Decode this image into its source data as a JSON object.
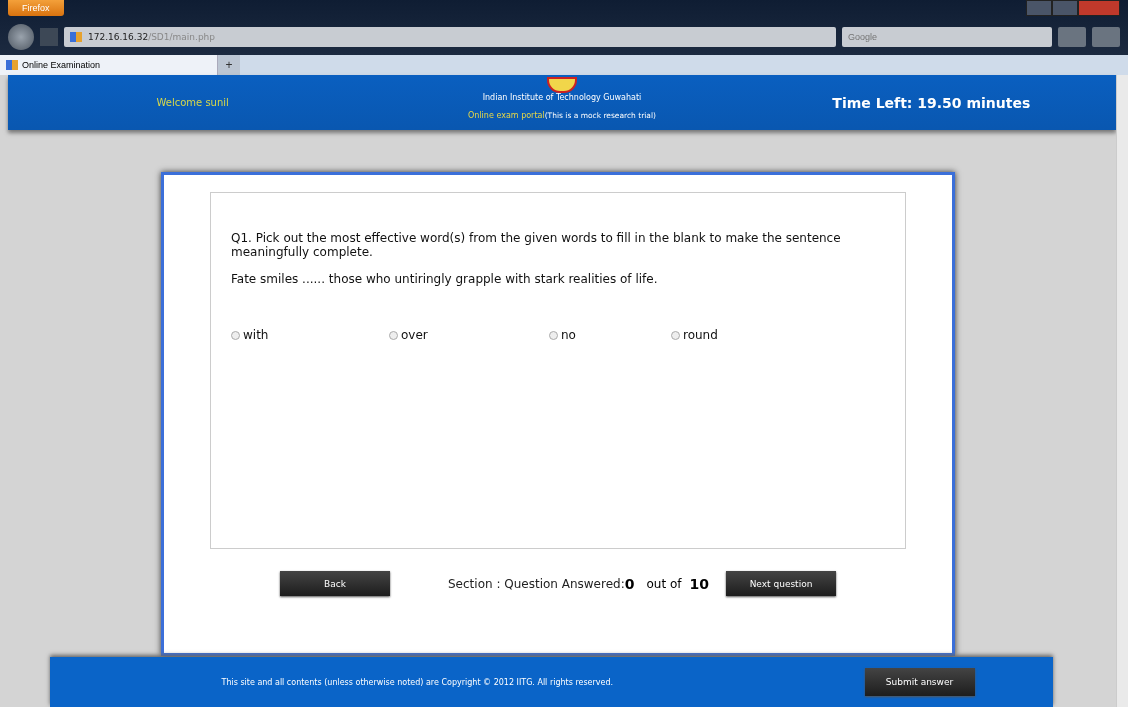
{
  "browser": {
    "menu_button": "Firefox",
    "url_host": "172.16.16.32",
    "url_path": "/SD1/main.php",
    "search_placeholder": "Google",
    "tabs": [
      {
        "label": "Online Examination",
        "selected": true
      }
    ],
    "new_tab": "+"
  },
  "header": {
    "welcome": "Welcome sunil",
    "institute": "Indian Institute of Technology Guwahati",
    "portal": "Online exam portal",
    "portal_note": "(This is a mock research trial)",
    "timer": "Time Left: 19.50 minutes"
  },
  "question": {
    "prompt": "Q1. Pick out the most effective word(s) from the given words to fill in the blank to make the sentence meaningfully complete.",
    "sentence": "Fate smiles ...... those who untiringly grapple with stark realities of life.",
    "options": [
      {
        "label": "with",
        "selected": false
      },
      {
        "label": "over",
        "selected": false
      },
      {
        "label": "no",
        "selected": false
      },
      {
        "label": "round",
        "selected": false
      }
    ]
  },
  "navigation": {
    "back": "Back",
    "status": "Section : Question Answered:",
    "answered": "0",
    "out_of": "out of",
    "total": "10",
    "next": "Next question"
  },
  "footer": {
    "copyright": "This site and all contents (unless otherwise noted) are Copyright © 2012 IITG. All rights reserved.",
    "submit": "Submit answer"
  }
}
